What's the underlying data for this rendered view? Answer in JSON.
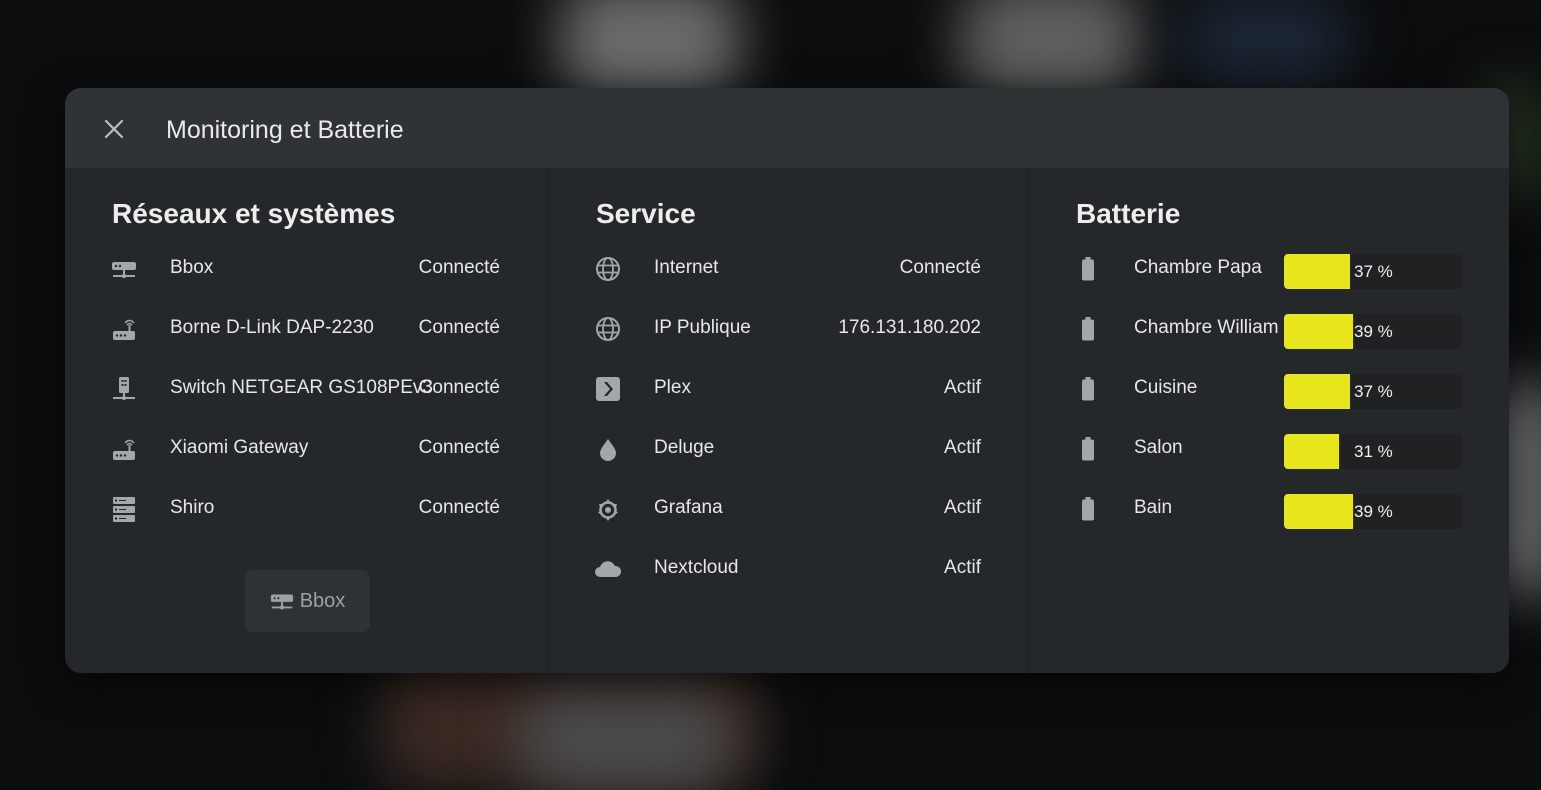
{
  "dialog": {
    "title": "Monitoring et Batterie"
  },
  "network": {
    "title": "Réseaux et systèmes",
    "items": [
      {
        "label": "Bbox",
        "status": "Connecté",
        "icon": "router-icon"
      },
      {
        "label": "Borne D-Link DAP-2230",
        "status": "Connecté",
        "icon": "wifi-router-icon"
      },
      {
        "label": "Switch NETGEAR GS108PEv3",
        "status": "Connecté",
        "icon": "switch-icon"
      },
      {
        "label": "Xiaomi Gateway",
        "status": "Connecté",
        "icon": "wifi-router-icon"
      },
      {
        "label": "Shiro",
        "status": "Connecté",
        "icon": "server-icon"
      }
    ],
    "button_label": "Bbox"
  },
  "service": {
    "title": "Service",
    "items": [
      {
        "label": "Internet",
        "status": "Connecté",
        "icon": "globe-icon"
      },
      {
        "label": "IP Publique",
        "status": "176.131.180.202",
        "icon": "globe-icon"
      },
      {
        "label": "Plex",
        "status": "Actif",
        "icon": "plex-icon"
      },
      {
        "label": "Deluge",
        "status": "Actif",
        "icon": "water-drop-icon"
      },
      {
        "label": "Grafana",
        "status": "Actif",
        "icon": "grafana-icon"
      },
      {
        "label": "Nextcloud",
        "status": "Actif",
        "icon": "cloud-icon"
      }
    ]
  },
  "battery": {
    "title": "Batterie",
    "bar_color": "#e6e61a",
    "items": [
      {
        "label": "Chambre Papa",
        "value": 37,
        "text": "37 %"
      },
      {
        "label": "Chambre William",
        "value": 39,
        "text": "39 %"
      },
      {
        "label": "Cuisine",
        "value": 37,
        "text": "37 %"
      },
      {
        "label": "Salon",
        "value": 31,
        "text": "31 %"
      },
      {
        "label": "Bain",
        "value": 39,
        "text": "39 %"
      }
    ]
  }
}
